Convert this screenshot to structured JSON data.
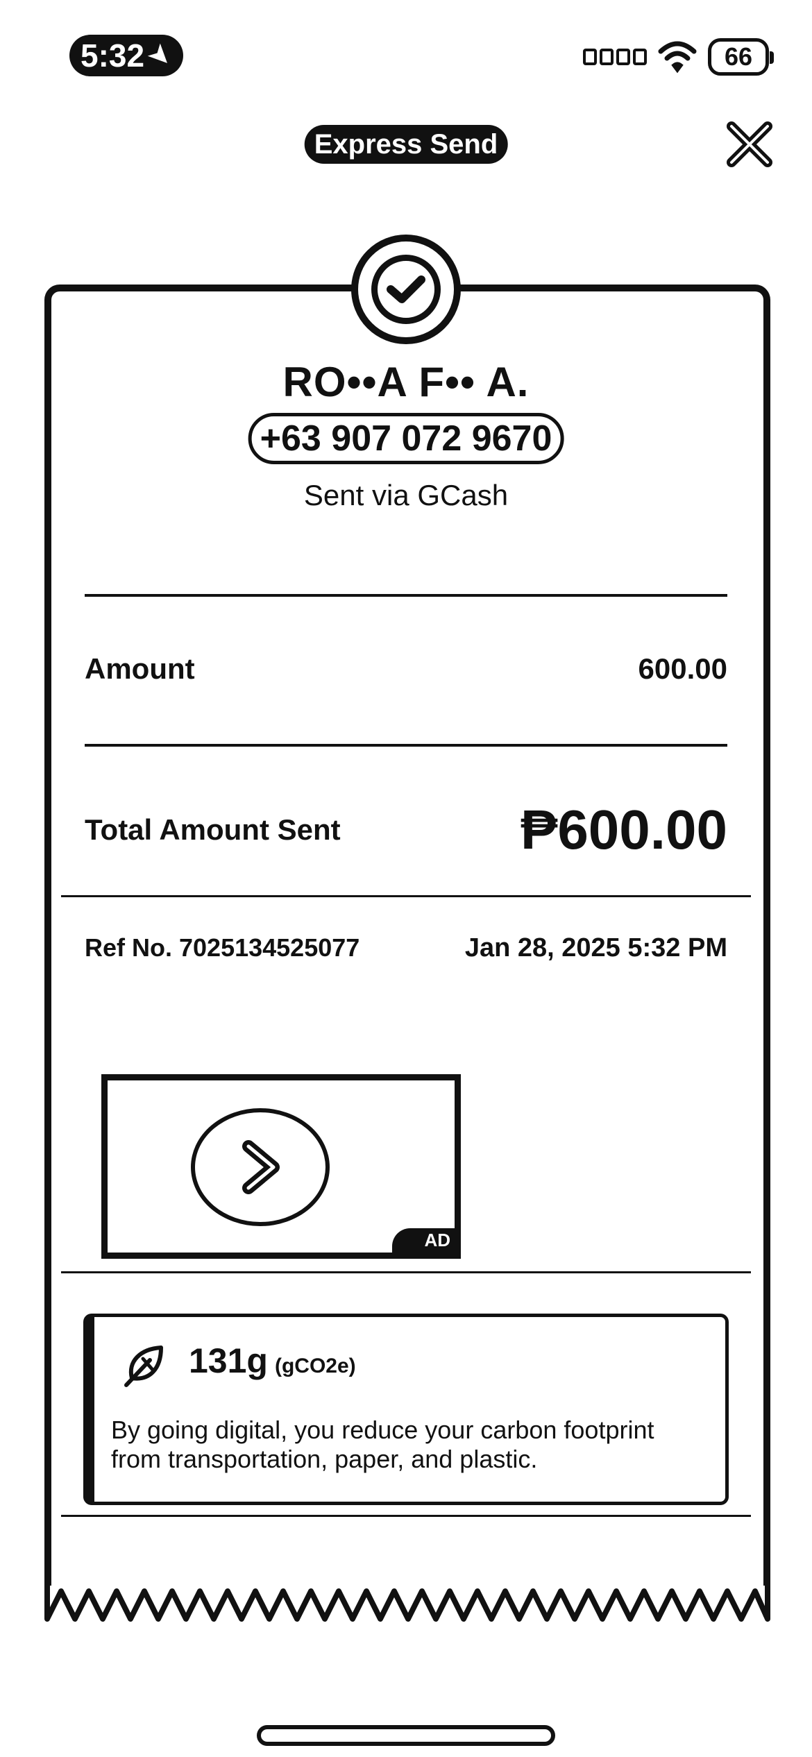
{
  "status_bar": {
    "time": "5:32",
    "battery": "66"
  },
  "header": {
    "title": "Express Send"
  },
  "receipt": {
    "recipient_name": "RO••A F•• A.",
    "recipient_phone": "+63 907 072 9670",
    "sent_via": "Sent via GCash",
    "amount_label": "Amount",
    "amount_value": "600.00",
    "total_label": "Total Amount Sent",
    "total_value": "₱600.00",
    "ref_no": "Ref No. 7025134525077",
    "date": "Jan 28, 2025 5:32 PM"
  },
  "ad": {
    "badge": "AD"
  },
  "carbon": {
    "amount": "131g",
    "unit": "(gCO2e)",
    "text": "By going digital, you reduce your carbon footprint from transportation, paper, and plastic."
  },
  "icons": [
    "location-arrow-icon",
    "signal-icon",
    "wifi-icon",
    "battery-icon",
    "close-icon",
    "check-icon",
    "chevron-right-icon",
    "leaf-icon"
  ]
}
